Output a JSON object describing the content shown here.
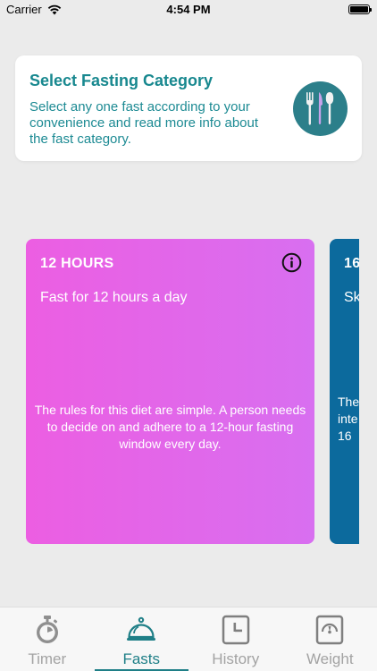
{
  "status_bar": {
    "carrier": "Carrier",
    "time": "4:54 PM"
  },
  "header": {
    "title": "Select Fasting Category",
    "description": "Select any one fast according to your convenience and read more info about the fast category.",
    "icon": "cutlery-icon",
    "icon_color": "#2c7f8a"
  },
  "fasts": [
    {
      "hours": "12 HOURS",
      "subtitle": "Fast for 12 hours a day",
      "description": "The rules for this diet are simple. A person needs to decide on and adhere to a 12-hour fasting window every day.",
      "color": "#e35fe6"
    },
    {
      "hours": "16",
      "subtitle": "Sk",
      "description": "The inte 16",
      "color": "#0c6a9d"
    }
  ],
  "tabs": [
    {
      "label": "Timer",
      "icon": "stopwatch-icon",
      "active": false
    },
    {
      "label": "Fasts",
      "icon": "cloche-icon",
      "active": true
    },
    {
      "label": "History",
      "icon": "clock-icon",
      "active": false
    },
    {
      "label": "Weight",
      "icon": "scale-icon",
      "active": false
    }
  ],
  "colors": {
    "accent": "#1f7f87",
    "inactive": "#a3a3a3"
  }
}
